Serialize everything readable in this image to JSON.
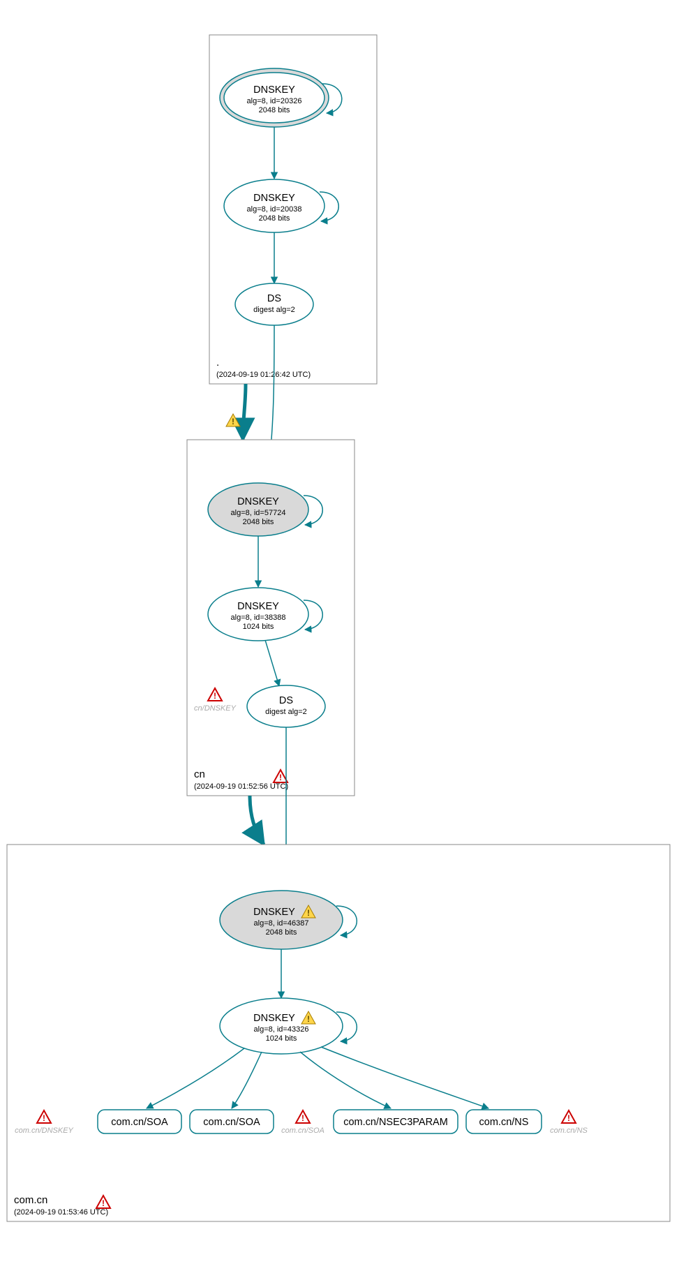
{
  "zones": {
    "root": {
      "label": ".",
      "timestamp": "(2024-09-19 01:26:42 UTC)"
    },
    "cn": {
      "label": "cn",
      "timestamp": "(2024-09-19 01:52:56 UTC)"
    },
    "comcn": {
      "label": "com.cn",
      "timestamp": "(2024-09-19 01:53:46 UTC)"
    }
  },
  "nodes": {
    "root_ksk": {
      "title": "DNSKEY",
      "l1": "alg=8, id=20326",
      "l2": "2048 bits"
    },
    "root_zsk": {
      "title": "DNSKEY",
      "l1": "alg=8, id=20038",
      "l2": "2048 bits"
    },
    "root_ds": {
      "title": "DS",
      "l1": "digest alg=2",
      "l2": ""
    },
    "cn_ksk": {
      "title": "DNSKEY",
      "l1": "alg=8, id=57724",
      "l2": "2048 bits"
    },
    "cn_zsk": {
      "title": "DNSKEY",
      "l1": "alg=8, id=38388",
      "l2": "1024 bits"
    },
    "cn_ds": {
      "title": "DS",
      "l1": "digest alg=2",
      "l2": ""
    },
    "comcn_ksk": {
      "title": "DNSKEY",
      "l1": "alg=8, id=46387",
      "l2": "2048 bits"
    },
    "comcn_zsk": {
      "title": "DNSKEY",
      "l1": "alg=8, id=43326",
      "l2": "1024 bits"
    }
  },
  "leaves": {
    "soa1": "com.cn/SOA",
    "soa2": "com.cn/SOA",
    "nsec": "com.cn/NSEC3PARAM",
    "ns": "com.cn/NS"
  },
  "ghosts": {
    "cn_dnskey": "cn/DNSKEY",
    "comcn_dnskey": "com.cn/DNSKEY",
    "comcn_soa": "com.cn/SOA",
    "comcn_ns": "com.cn/NS"
  },
  "colors": {
    "stroke": "#0a7e8c",
    "grey": "#d9d9d9"
  }
}
